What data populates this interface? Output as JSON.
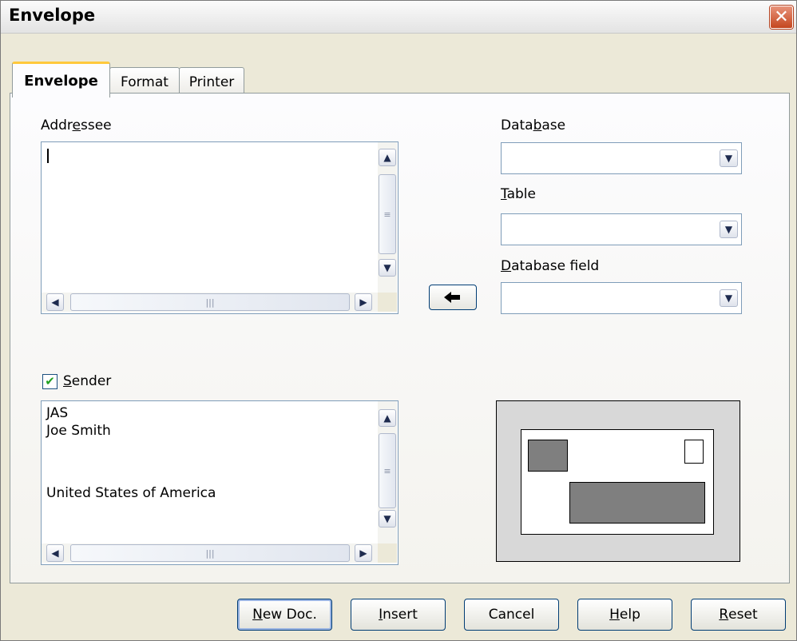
{
  "window": {
    "title": "Envelope",
    "close_label": "✕"
  },
  "tabs": [
    {
      "label": "Envelope",
      "active": true
    },
    {
      "label": "Format",
      "active": false
    },
    {
      "label": "Printer",
      "active": false
    }
  ],
  "addressee": {
    "label_pre": "Addr",
    "label_accel": "e",
    "label_post": "ssee",
    "value": ""
  },
  "database": {
    "label_pre": "Data",
    "label_accel": "b",
    "label_post": "ase",
    "value": ""
  },
  "table": {
    "label_pre": "",
    "label_accel": "T",
    "label_post": "able",
    "value": ""
  },
  "database_field": {
    "label_pre": "",
    "label_accel": "D",
    "label_post": "atabase field",
    "value": ""
  },
  "sender": {
    "checked": true,
    "label_pre": "",
    "label_accel": "S",
    "label_post": "ender",
    "lines": [
      "JAS",
      "Joe Smith",
      "",
      "",
      "United States of America"
    ]
  },
  "icons": {
    "insert_field": "arrow-left-icon",
    "scroll_up": "chevron-up-icon",
    "scroll_down": "chevron-down-icon",
    "scroll_left": "chevron-left-icon",
    "scroll_right": "chevron-right-icon",
    "dropdown": "chevron-down-icon",
    "check": "checkmark-icon"
  },
  "buttons": {
    "new_doc": {
      "pre": "",
      "accel": "N",
      "post": "ew Doc."
    },
    "insert": {
      "pre": "",
      "accel": "I",
      "post": "nsert"
    },
    "cancel": {
      "pre": "Cancel",
      "accel": "",
      "post": ""
    },
    "help": {
      "pre": "",
      "accel": "H",
      "post": "elp"
    },
    "reset": {
      "pre": "",
      "accel": "R",
      "post": "eset"
    }
  },
  "colors": {
    "tab_highlight": "#ffc83c",
    "preview_block": "#7f7f7f",
    "checkmark": "#21a121",
    "close_button": "#c4461f"
  }
}
